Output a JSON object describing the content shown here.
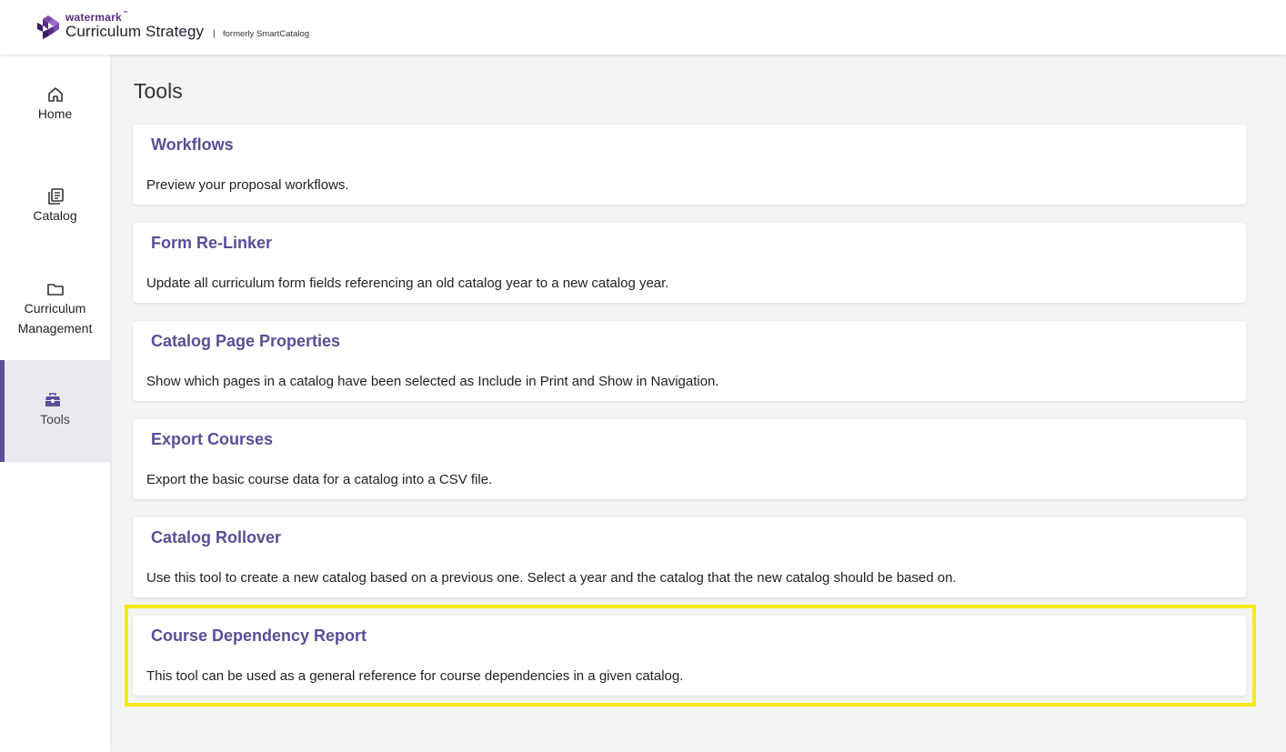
{
  "header": {
    "brand_small": "watermark",
    "brand_tm": "™",
    "brand_main": "Curriculum Strategy",
    "separator": "|",
    "formerly": "formerly SmartCatalog",
    "brand_color": "#5b2c83"
  },
  "sidebar": {
    "items": [
      {
        "label": "Home",
        "icon": "home-icon"
      },
      {
        "label": "Catalog",
        "icon": "catalog-icon"
      },
      {
        "label": "Curriculum Management",
        "icon": "folder-icon"
      },
      {
        "label": "Tools",
        "icon": "toolbox-icon",
        "active": true
      }
    ],
    "active_color": "#5a4e96"
  },
  "main": {
    "title": "Tools",
    "cards": [
      {
        "title": "Workflows",
        "description": "Preview your proposal workflows."
      },
      {
        "title": "Form Re-Linker",
        "description": "Update all curriculum form fields referencing an old catalog year to a new catalog year."
      },
      {
        "title": "Catalog Page Properties",
        "description": "Show which pages in a catalog have been selected as Include in Print and Show in Navigation."
      },
      {
        "title": "Export Courses",
        "description": "Export the basic course data for a catalog into a CSV file."
      },
      {
        "title": "Catalog Rollover",
        "description": "Use this tool to create a new catalog based on a previous one. Select a year and the catalog that the new catalog should be based on."
      },
      {
        "title": "Course Dependency Report",
        "description": "This tool can be used as a general reference for course dependencies in a given catalog.",
        "highlighted": true
      }
    ],
    "card_title_color": "#5a4e96",
    "highlight_color": "#f5ea14"
  }
}
